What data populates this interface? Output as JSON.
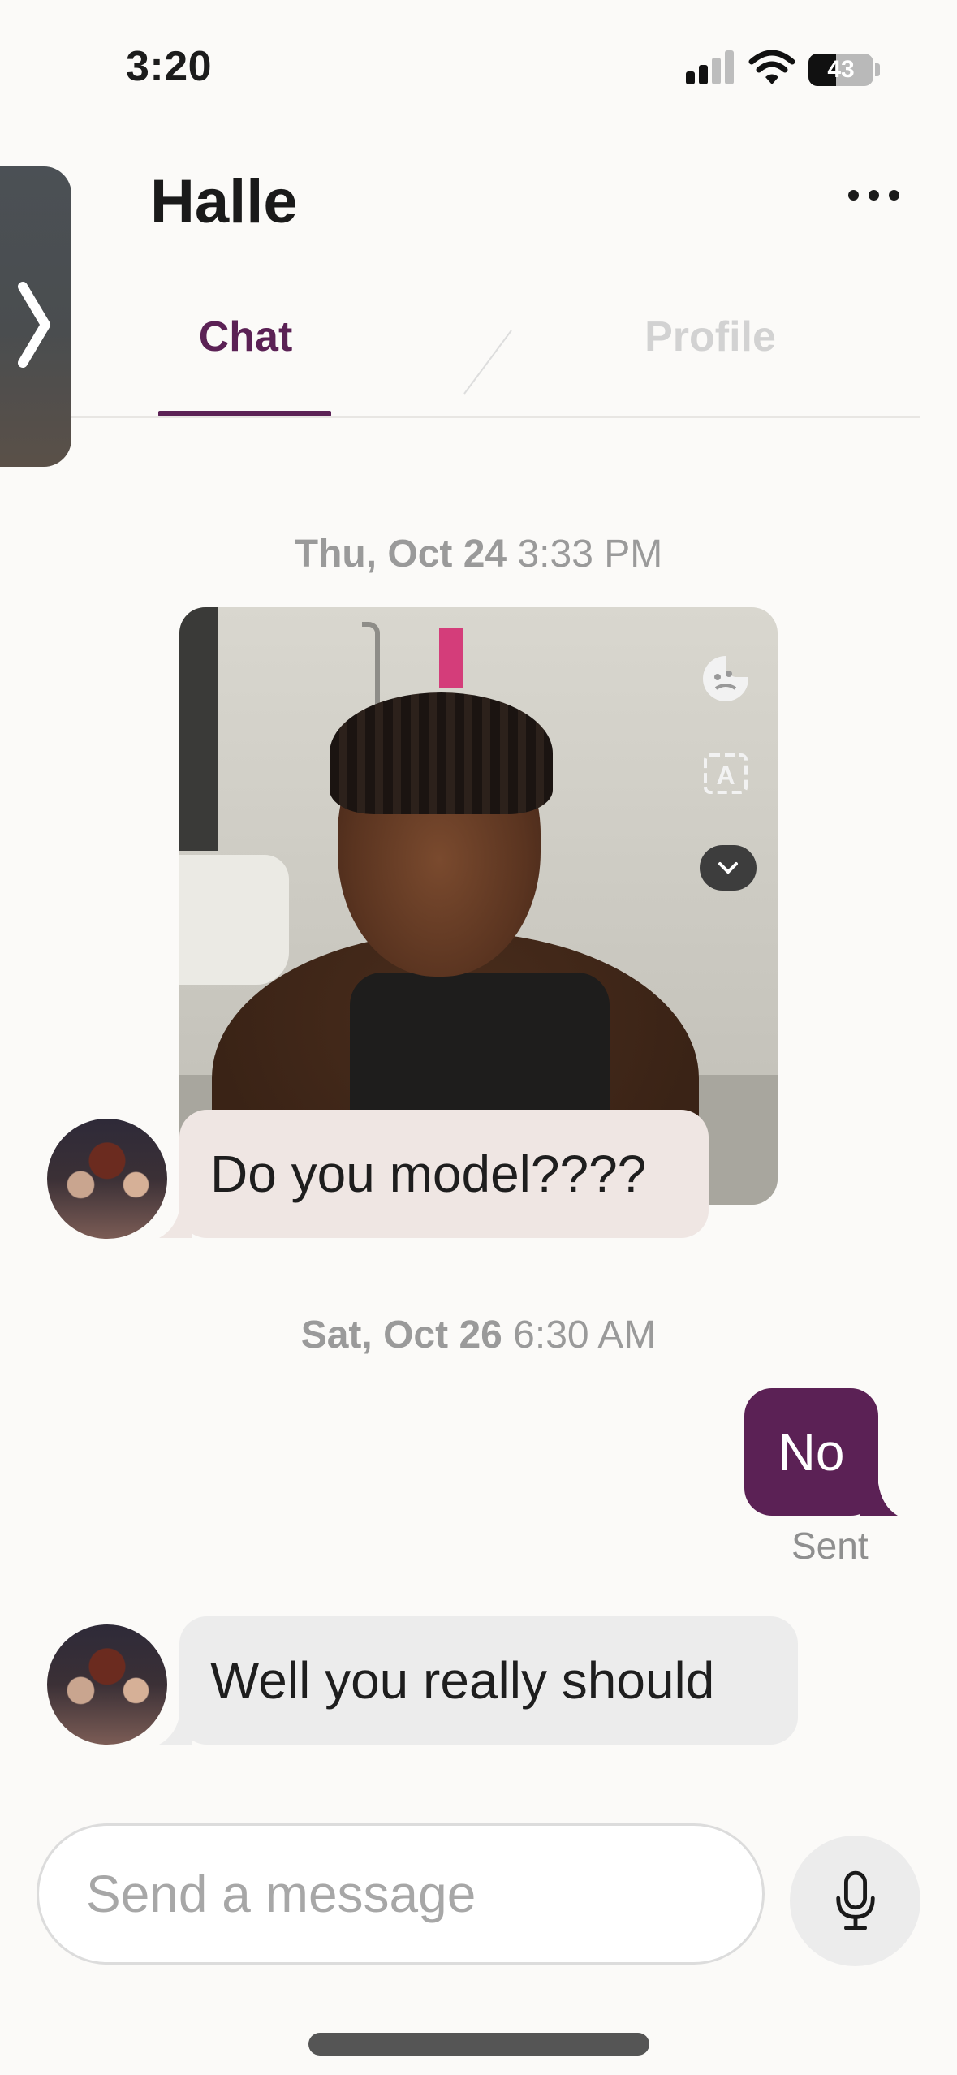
{
  "status_bar": {
    "time": "3:20",
    "battery": "43"
  },
  "header": {
    "contact_name": "Halle"
  },
  "tabs": [
    {
      "label": "Chat",
      "active": true
    },
    {
      "label": "Profile",
      "active": false
    }
  ],
  "messages": [
    {
      "date_day": "Thu, Oct 24",
      "date_time": "3:33 PM",
      "sender": "Halle",
      "has_photo": true,
      "text": "Do you model????"
    },
    {
      "date_day": "Sat, Oct 26",
      "date_time": "6:30 AM",
      "sender": "me",
      "text": "No",
      "status": "Sent"
    },
    {
      "sender": "Halle",
      "text": "Well you really should"
    }
  ],
  "composer": {
    "placeholder": "Send a message",
    "value": ""
  },
  "colors": {
    "accent": "#5b2155",
    "bubble_in_photo": "#efe6e3",
    "bubble_in": "#ececec"
  },
  "icons": [
    "signal-icon",
    "wifi-icon",
    "battery-icon",
    "back-chevron-icon",
    "more-icon",
    "side-panel-chevron-icon",
    "emoji-reaction-icon",
    "translate-icon",
    "chevron-down-icon",
    "microphone-icon"
  ]
}
